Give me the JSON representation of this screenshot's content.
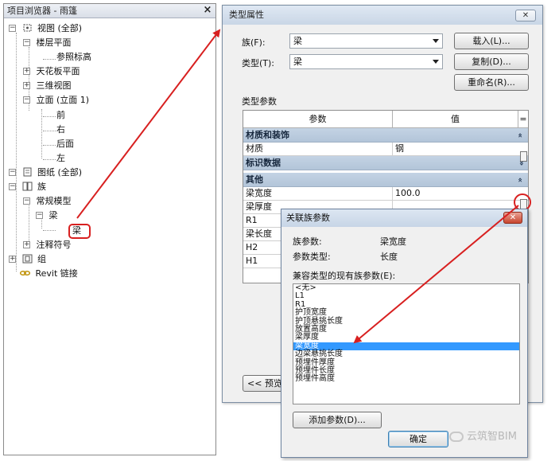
{
  "project_browser": {
    "title": "项目浏览器 - 雨篷",
    "close_glyph": "×",
    "tree": {
      "views": "视图 (全部)",
      "floor_plans": "楼层平面",
      "ref_level": "参照标高",
      "ceiling_plans": "天花板平面",
      "views_3d": "三维视图",
      "elevations": "立面 (立面 1)",
      "elev_front": "前",
      "elev_right": "右",
      "elev_back": "后面",
      "elev_left": "左",
      "sheets": "图纸 (全部)",
      "families": "族",
      "generic_models": "常规模型",
      "beam_family": "梁",
      "beam_type": "梁",
      "annotation_symbols": "注释符号",
      "groups": "组",
      "revit_links": "Revit 链接"
    }
  },
  "type_properties": {
    "title": "类型属性",
    "close_glyph": "✕",
    "family_label": "族(F):",
    "family_value": "梁",
    "type_label": "类型(T):",
    "type_value": "梁",
    "load_button": "载入(L)...",
    "duplicate_button": "复制(D)...",
    "rename_button": "重命名(R)...",
    "type_params_label": "类型参数",
    "table": {
      "col_param": "参数",
      "col_value": "值",
      "col_extra": "=",
      "groups": {
        "materials": "材质和装饰",
        "identity": "标识数据",
        "other": "其他"
      },
      "rows": {
        "material_name": "材质",
        "material_value": "钢",
        "beam_width_name": "梁宽度",
        "beam_width_value": "100.0",
        "beam_thickness_name": "梁厚度",
        "r1_name": "R1",
        "beam_length_name": "梁长度",
        "h2_name": "H2",
        "h1_name": "H1"
      },
      "collapse_glyph": "»",
      "expand_glyph": "»"
    },
    "preview_button": "<< 预览"
  },
  "associate_dialog": {
    "title": "关联族参数",
    "close_glyph": "✕",
    "family_param_label": "族参数:",
    "family_param_value": "梁宽度",
    "param_type_label": "参数类型:",
    "param_type_value": "长度",
    "compatible_label": "兼容类型的现有族参数(E):",
    "list_items": [
      "<无>",
      "L1",
      "R1",
      "护顶宽度",
      "护顶悬挑长度",
      "放置高度",
      "梁厚度",
      "梁宽度",
      "边梁悬挑长度",
      "预埋件厚度",
      "预埋件长度",
      "预埋件高度"
    ],
    "selected_index": 7,
    "add_param_button": "添加参数(D)...",
    "ok_button": "确定"
  },
  "watermark": "云筑智BIM",
  "colors": {
    "annotation_red": "#d82020",
    "selection_blue": "#3399ff",
    "group_header": "#b3c5d9"
  }
}
